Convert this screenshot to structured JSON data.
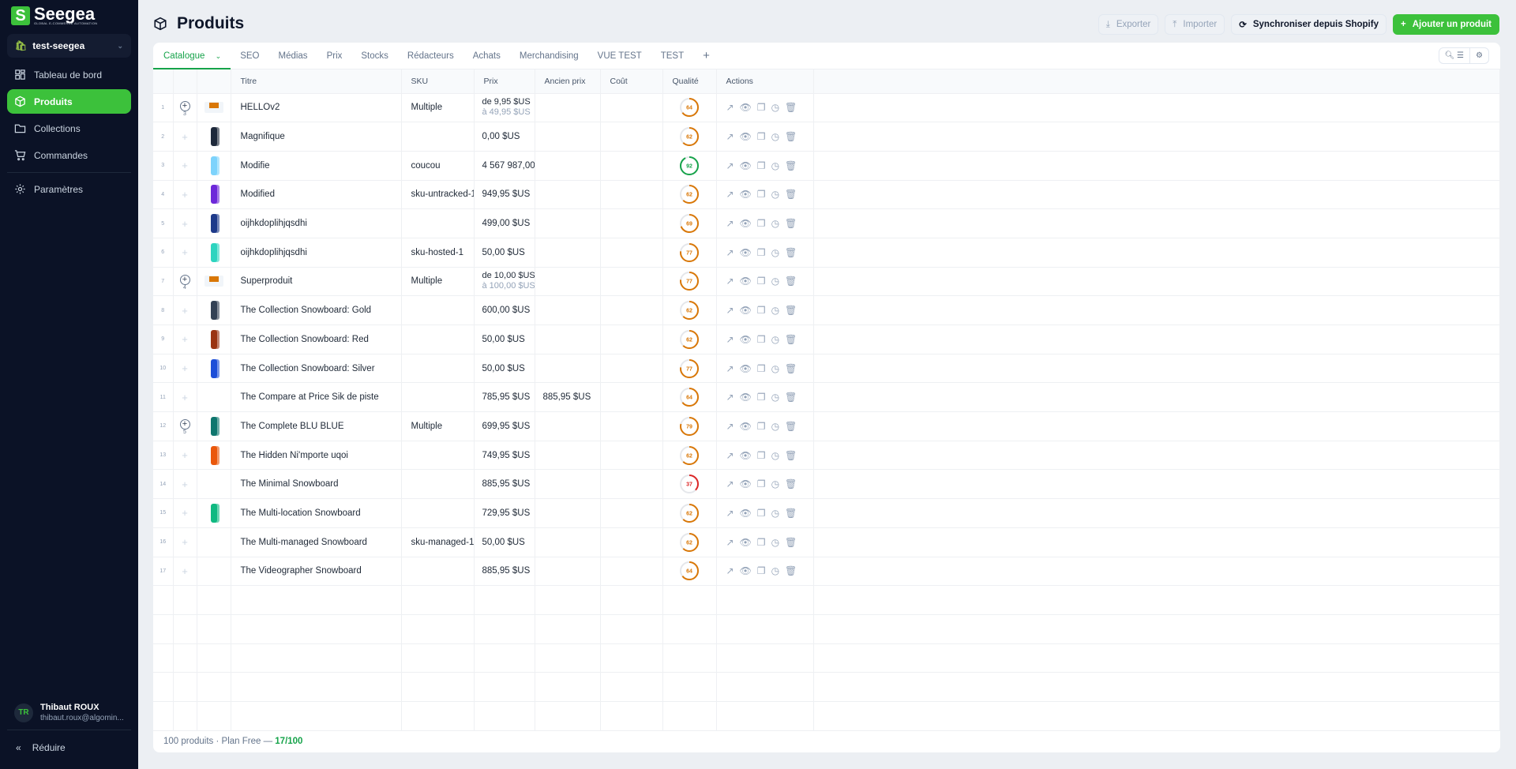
{
  "brand": {
    "name": "Seegea",
    "tagline": "GLOBAL E-COMMERCE AUTOMATION",
    "color": "#3cc13b"
  },
  "store": "test-seegea",
  "nav": [
    {
      "label": "Tableau de bord",
      "icon": "dashboard-icon"
    },
    {
      "label": "Produits",
      "icon": "box-icon",
      "active": true
    },
    {
      "label": "Collections",
      "icon": "folder-icon"
    },
    {
      "label": "Commandes",
      "icon": "cart-icon"
    },
    {
      "label": "Paramètres",
      "icon": "gear-icon"
    }
  ],
  "user": {
    "initials": "TR",
    "name": "Thibaut ROUX",
    "email": "thibaut.roux@algomin..."
  },
  "collapse_label": "Réduire",
  "page_title": "Produits",
  "actions": {
    "export": "Exporter",
    "import": "Importer",
    "sync": "Synchroniser depuis Shopify",
    "add": "Ajouter un produit"
  },
  "tabs": [
    "Catalogue",
    "SEO",
    "Médias",
    "Prix",
    "Stocks",
    "Rédacteurs",
    "Achats",
    "Merchandising",
    "VUE TEST",
    "TEST"
  ],
  "columns": [
    "Titre",
    "SKU",
    "Prix",
    "Ancien prix",
    "Coût",
    "Qualité",
    "Actions"
  ],
  "rows": [
    {
      "n": "1",
      "variants": "3",
      "img": "box",
      "title": "HELLOv2",
      "sku": "Multiple",
      "price": "de 9,95 $US",
      "price_to": "à 49,95 $US",
      "old": "",
      "quality": 64
    },
    {
      "n": "2",
      "img": "#1e293b",
      "title": "Magnifique",
      "sku": "",
      "price": "0,00 $US",
      "old": "",
      "quality": 62
    },
    {
      "n": "3",
      "img": "#7dd3fc",
      "title": "Modifie",
      "sku": "coucou",
      "price": "4 567 987,00",
      "old": "",
      "quality": 92
    },
    {
      "n": "4",
      "img": "#6d28d9",
      "title": "Modified",
      "sku": "sku-untracked-1",
      "price": "949,95 $US",
      "old": "",
      "quality": 62
    },
    {
      "n": "5",
      "img": "#1e3a8a",
      "title": "oijhkdoplihjqsdhi",
      "sku": "",
      "price": "499,00 $US",
      "old": "",
      "quality": 69
    },
    {
      "n": "6",
      "img": "#2dd4bf",
      "title": "oijhkdoplihjqsdhi",
      "sku": "sku-hosted-1",
      "price": "50,00 $US",
      "old": "",
      "quality": 77
    },
    {
      "n": "7",
      "variants": "4",
      "img": "box",
      "title": "Superproduit",
      "sku": "Multiple",
      "price": "de 10,00 $US",
      "price_to": "à 100,00 $US",
      "old": "",
      "quality": 77
    },
    {
      "n": "8",
      "img": "#334155",
      "title": "The Collection Snowboard: Gold",
      "sku": "",
      "price": "600,00 $US",
      "old": "",
      "quality": 62
    },
    {
      "n": "9",
      "img": "#9a3412",
      "title": "The Collection Snowboard: Red",
      "sku": "",
      "price": "50,00 $US",
      "old": "",
      "quality": 62
    },
    {
      "n": "10",
      "img": "#1d4ed8",
      "title": "The Collection Snowboard: Silver",
      "sku": "",
      "price": "50,00 $US",
      "old": "",
      "quality": 77
    },
    {
      "n": "11",
      "img": "",
      "title": "The Compare at Price Sik de piste",
      "sku": "",
      "price": "785,95 $US",
      "old": "885,95 $US",
      "quality": 64
    },
    {
      "n": "12",
      "variants": "5",
      "img": "#0f766e",
      "title": "The Complete BLU BLUE",
      "sku": "Multiple",
      "price": "699,95 $US",
      "old": "",
      "quality": 79
    },
    {
      "n": "13",
      "img": "#ea580c",
      "title": "The Hidden Ni'mporte uqoi",
      "sku": "",
      "price": "749,95 $US",
      "old": "",
      "quality": 62
    },
    {
      "n": "14",
      "img": "",
      "title": "The Minimal Snowboard",
      "sku": "",
      "price": "885,95 $US",
      "old": "",
      "quality": 37
    },
    {
      "n": "15",
      "img": "#10b981",
      "title": "The Multi-location Snowboard",
      "sku": "",
      "price": "729,95 $US",
      "old": "",
      "quality": 62
    },
    {
      "n": "16",
      "img": "",
      "title": "The Multi-managed Snowboard",
      "sku": "sku-managed-1",
      "price": "50,00 $US",
      "old": "",
      "quality": 62
    },
    {
      "n": "17",
      "img": "",
      "title": "The Videographer Snowboard",
      "sku": "",
      "price": "885,95 $US",
      "old": "",
      "quality": 64
    }
  ],
  "footer": {
    "count": "100 produits",
    "plan": "· Plan Free —",
    "usage": "17/100"
  },
  "quality_colors": {
    "high": "#16a34a",
    "mid": "#d97706",
    "low": "#dc2626"
  }
}
